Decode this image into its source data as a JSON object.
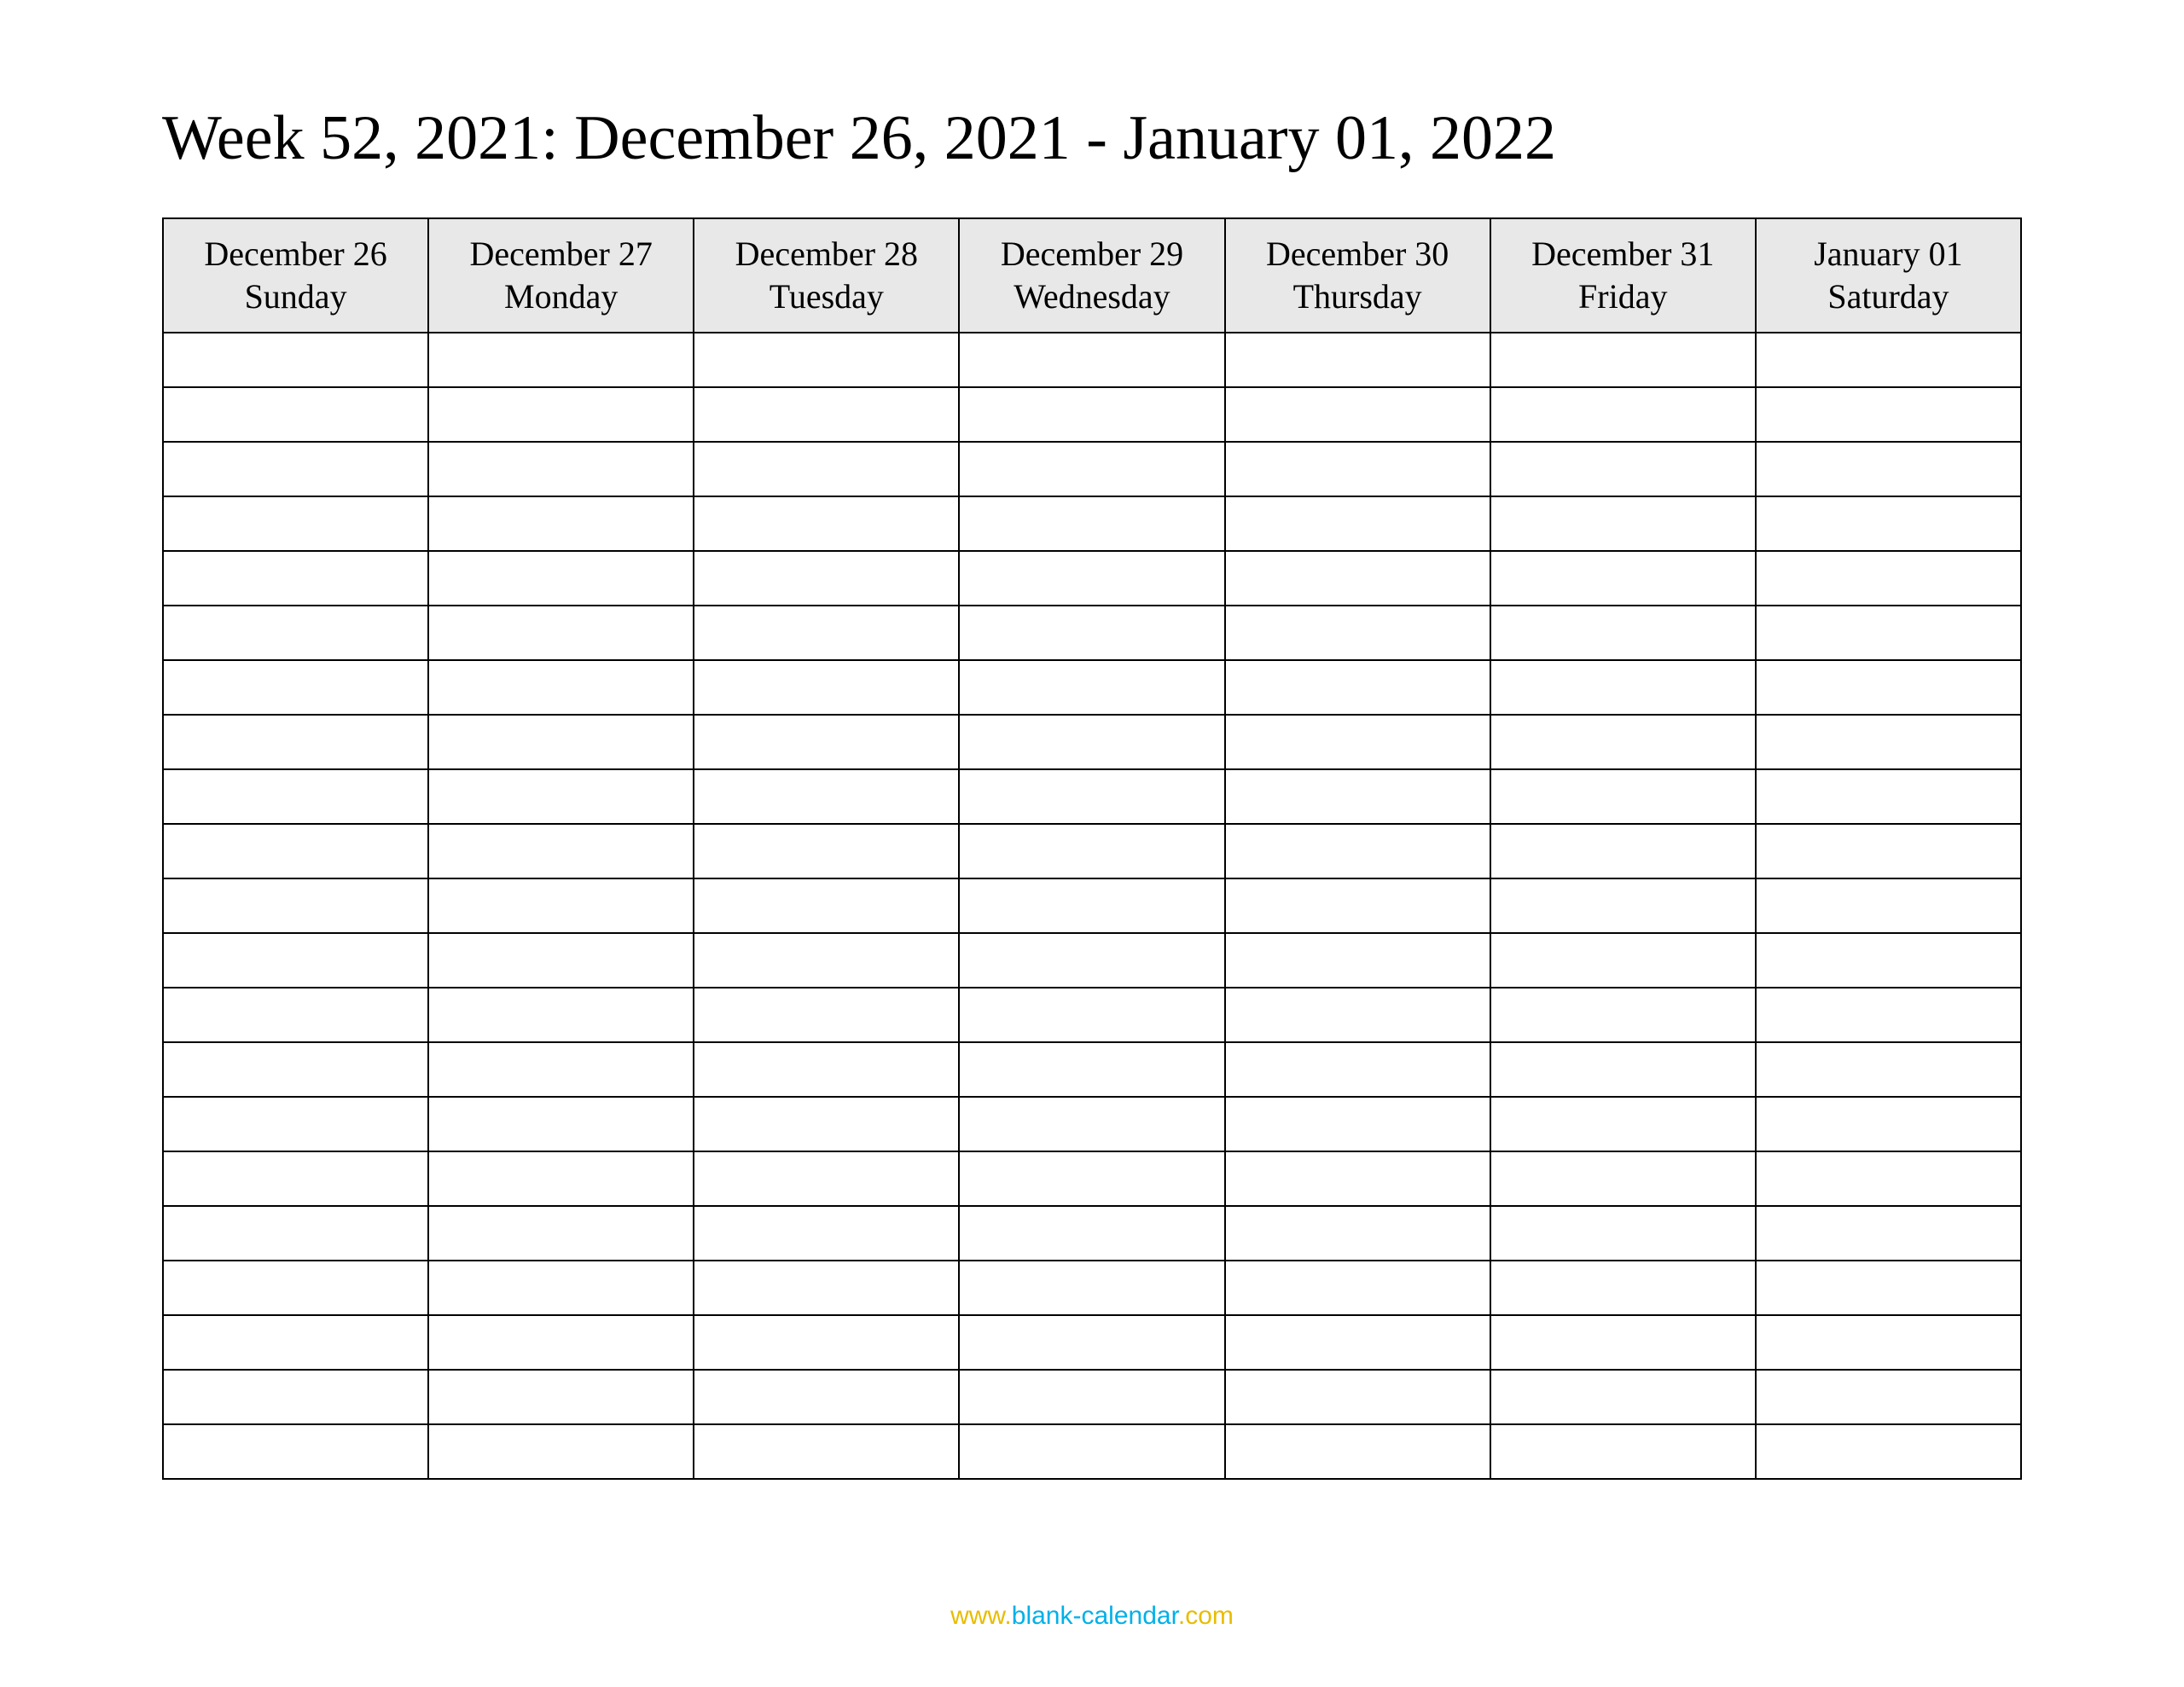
{
  "title": "Week 52, 2021: December 26, 2021 - January 01, 2022",
  "columns": [
    {
      "date": "December 26",
      "dow": "Sunday"
    },
    {
      "date": "December 27",
      "dow": "Monday"
    },
    {
      "date": "December 28",
      "dow": "Tuesday"
    },
    {
      "date": "December 29",
      "dow": "Wednesday"
    },
    {
      "date": "December 30",
      "dow": "Thursday"
    },
    {
      "date": "December 31",
      "dow": "Friday"
    },
    {
      "date": "January 01",
      "dow": "Saturday"
    }
  ],
  "row_count": 21,
  "footer": {
    "www": "www.",
    "domain": "blank-calendar",
    "com": ".com",
    "href": "http://www.blank-calendar.com"
  }
}
